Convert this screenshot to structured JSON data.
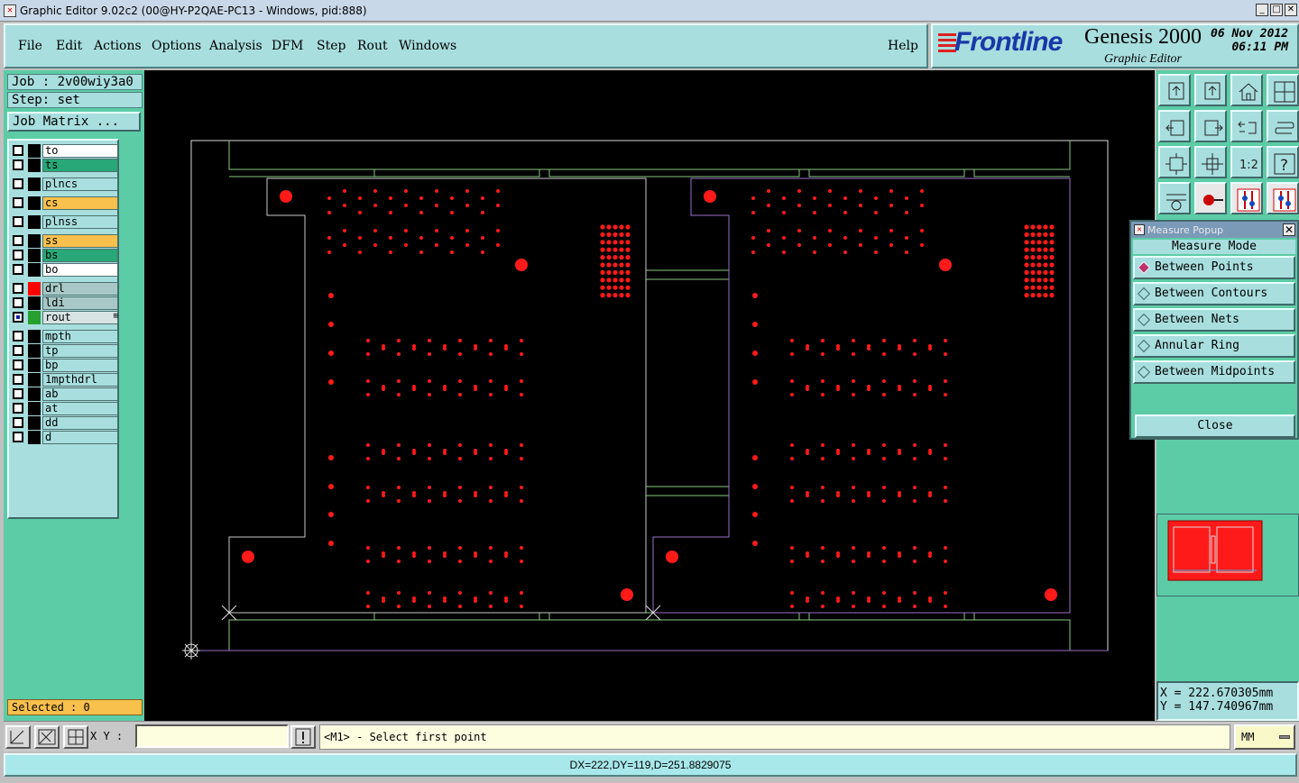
{
  "window": {
    "title": "Graphic Editor 9.02c2 (00@HY-P2QAE-PC13 - Windows, pid:888)"
  },
  "menu": {
    "file": "File",
    "edit": "Edit",
    "actions": "Actions",
    "options": "Options",
    "analysis": "Analysis",
    "dfm": "DFM",
    "step": "Step",
    "rout": "Rout",
    "windows": "Windows",
    "help": "Help"
  },
  "brand": {
    "frontline": "Frontline",
    "product": "Genesis 2000",
    "subtitle": "Graphic Editor",
    "date": "06 Nov 2012",
    "time": "06:11 PM"
  },
  "job": {
    "job_label": "Job : 2v00wiy3a0",
    "step_label": "Step: set",
    "matrix_button": "Job Matrix ..."
  },
  "layers": [
    {
      "name": "to",
      "bg": "#ffffff",
      "swatch": "#000000"
    },
    {
      "name": "ts",
      "bg": "#28a878",
      "swatch": "#000000"
    },
    {
      "name": "plncs",
      "bg": "#a8dede",
      "swatch": "#000000"
    },
    {
      "name": "cs",
      "bg": "#f8c04c",
      "swatch": "#000000"
    },
    {
      "name": "plnss",
      "bg": "#a8dede",
      "swatch": "#000000"
    },
    {
      "name": "ss",
      "bg": "#f8c04c",
      "swatch": "#000000"
    },
    {
      "name": "bs",
      "bg": "#28a878",
      "swatch": "#000000"
    },
    {
      "name": "bo",
      "bg": "#ffffff",
      "swatch": "#000000"
    },
    {
      "name": "drl",
      "bg": "#a8c8c8",
      "swatch": "#ff0000"
    },
    {
      "name": "ldi",
      "bg": "#a8c8c8",
      "swatch": "#000000"
    },
    {
      "name": "rout",
      "bg": "#d8e4e4",
      "swatch": "#28a030",
      "mark": "⊞",
      "active": true
    },
    {
      "name": "mpth",
      "bg": "#a8dede",
      "swatch": "#000000"
    },
    {
      "name": "tp",
      "bg": "#a8dede",
      "swatch": "#000000"
    },
    {
      "name": "bp",
      "bg": "#a8dede",
      "swatch": "#000000"
    },
    {
      "name": "1mpthdrl",
      "bg": "#a8dede",
      "swatch": "#000000"
    },
    {
      "name": "ab",
      "bg": "#a8dede",
      "swatch": "#000000"
    },
    {
      "name": "at",
      "bg": "#a8dede",
      "swatch": "#000000"
    },
    {
      "name": "dd",
      "bg": "#a8dede",
      "swatch": "#000000"
    },
    {
      "name": "d",
      "bg": "#a8dede",
      "swatch": "#000000"
    }
  ],
  "selected": "Selected : 0",
  "toolbar_icons": [
    "zoom-home-icon",
    "zoom-home-icon",
    "home-icon",
    "window-icon",
    "pan-left-icon",
    "pan-right-icon",
    "undo-icon",
    "redo-icon",
    "fit-screen-icon",
    "fit-center-icon",
    "one-to-two-icon",
    "help-icon",
    "settings-icon",
    "probe-icon",
    "snap-active-icon",
    "snap-active-icon"
  ],
  "toolbar_text": {
    "ratio": "1:2",
    "question": "?"
  },
  "measure_popup": {
    "title": "Measure Popup",
    "header": "Measure Mode",
    "options": [
      "Between Points",
      "Between Contours",
      "Between Nets",
      "Annular Ring",
      "Between Midpoints"
    ],
    "selected_index": 0,
    "close": "Close"
  },
  "coords": {
    "x": "X = 222.670305mm",
    "y": "Y = 147.740967mm"
  },
  "command": {
    "xy_label": "X Y :",
    "xy_value": "",
    "message": "<M1> - Select first point",
    "unit": "MM"
  },
  "status": "DX=222,DY=119,D=251.8829075",
  "colors": {
    "accent": "#5ccca6",
    "panel": "#a8dede",
    "pad": "#ff0000",
    "outline_green": "#8ac880",
    "outline_purple": "#9a70c8"
  }
}
